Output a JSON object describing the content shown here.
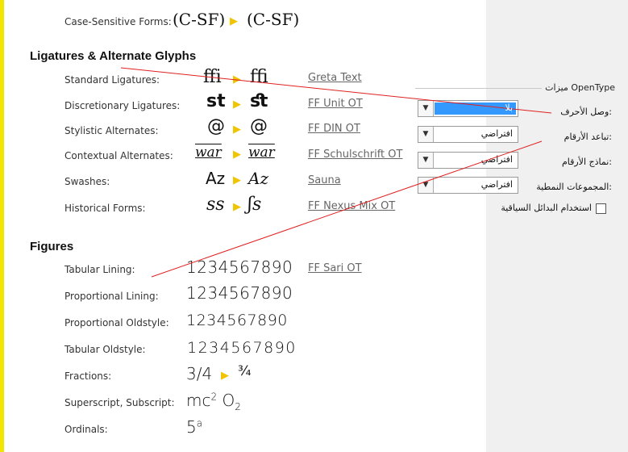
{
  "top_row": {
    "label": "Case-Sensitive Forms:",
    "sample_before": "(C-SF)",
    "sample_after": "(C-SF)"
  },
  "ligatures": {
    "title": "Ligatures & Alternate Glyphs",
    "rows": [
      {
        "label": "Standard Ligatures:",
        "before": "ffi",
        "after": "ﬃ",
        "font": "Greta Text"
      },
      {
        "label": "Discretionary Ligatures:",
        "before": "st",
        "after": "ﬆ",
        "font": "FF Unit OT"
      },
      {
        "label": "Stylistic Alternates:",
        "before": "@",
        "after": "@",
        "font": "FF DIN OT"
      },
      {
        "label": "Contextual Alternates:",
        "before": "war",
        "after": "war",
        "font": "FF Schulschrift OT"
      },
      {
        "label": "Swashes:",
        "before": "Az",
        "after": "Az",
        "font": "Sauna"
      },
      {
        "label": "Historical Forms:",
        "before": "ss",
        "after": "ʃs",
        "font": "FF Nexus Mix OT"
      }
    ]
  },
  "figures": {
    "title": "Figures",
    "rows": [
      {
        "label": "Tabular Lining:",
        "sample": "1234567890",
        "font": "FF Sari OT"
      },
      {
        "label": "Proportional Lining:",
        "sample": "1234567890"
      },
      {
        "label": "Proportional Oldstyle:",
        "sample": "1234567890"
      },
      {
        "label": "Tabular Oldstyle:",
        "sample": "1234567890"
      },
      {
        "label": "Fractions:",
        "before": "3/4",
        "after": "¾"
      },
      {
        "label": "Superscript, Subscript:",
        "mc": "mc",
        "sup": "2",
        "o": "O",
        "sub": "2"
      },
      {
        "label": "Ordinals:",
        "base": "5",
        "sup": "a"
      }
    ]
  },
  "opentype": {
    "title": "ميزات OpenType",
    "rows": [
      {
        "label": "وصل الأحرف:",
        "value": "بلا",
        "selected": true
      },
      {
        "label": "تباعد الأرقام:",
        "value": "افتراضي"
      },
      {
        "label": "نماذج الأرقام:",
        "value": "افتراضي"
      },
      {
        "label": "المجموعات النمطية:",
        "value": "افتراضي"
      }
    ],
    "checkbox_label": "استخدام البدائل السياقية"
  },
  "colors": {
    "accent_yellow": "#f2e500",
    "arrow": "#f0c400",
    "selection": "#3399ff",
    "annotation_line": "#e02020"
  }
}
